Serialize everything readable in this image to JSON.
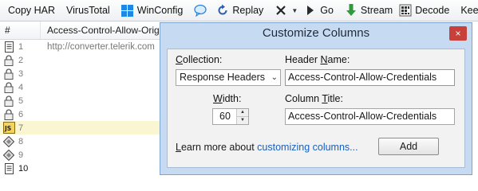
{
  "toolbar": {
    "copy_har": "Copy HAR",
    "virustotal": "VirusTotal",
    "winconfig": "WinConfig",
    "replay": "Replay",
    "go": "Go",
    "stream": "Stream",
    "decode": "Decode",
    "keep": "Keep: All se"
  },
  "list": {
    "col_hash": "#",
    "col_header": "Access-Control-Allow-Origin",
    "rows": [
      {
        "num": "1",
        "value": "http://converter.telerik.com"
      },
      {
        "num": "2",
        "value": ""
      },
      {
        "num": "3",
        "value": ""
      },
      {
        "num": "4",
        "value": ""
      },
      {
        "num": "5",
        "value": ""
      },
      {
        "num": "6",
        "value": ""
      },
      {
        "num": "7",
        "value": ""
      },
      {
        "num": "8",
        "value": ""
      },
      {
        "num": "9",
        "value": ""
      },
      {
        "num": "10",
        "value": ""
      }
    ]
  },
  "dialog": {
    "title": "Customize Columns",
    "close_label": "×",
    "collection_label_pre": "",
    "collection_label_u": "C",
    "collection_label_post": "ollection:",
    "collection_value": "Response Headers",
    "header_name_label_pre": "Header ",
    "header_name_label_u": "N",
    "header_name_label_post": "ame:",
    "header_name_value": "Access-Control-Allow-Credentials",
    "width_label_pre": "",
    "width_label_u": "W",
    "width_label_post": "idth:",
    "width_value": "60",
    "column_title_label_pre": "Column ",
    "column_title_label_u": "T",
    "column_title_label_post": "itle:",
    "column_title_value": "Access-Control-Allow-Credentials",
    "learn_more_pre": "",
    "learn_more_u": "L",
    "learn_more_post": "earn more about ",
    "learn_more_link": "customizing columns...",
    "add_label": "Add"
  }
}
